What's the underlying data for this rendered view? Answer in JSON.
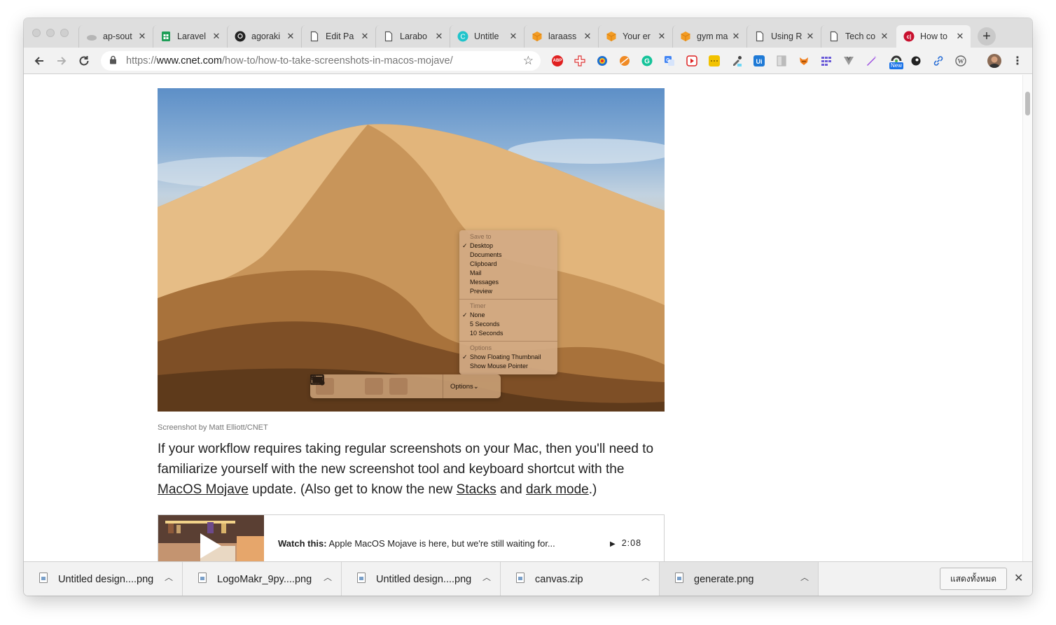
{
  "tabs": [
    {
      "title": "ap-sout",
      "icon": "generic-gray-icon"
    },
    {
      "title": "Laravel",
      "icon": "google-sheets-icon"
    },
    {
      "title": "agoraki",
      "icon": "github-icon"
    },
    {
      "title": "Edit Pa",
      "icon": "document-icon"
    },
    {
      "title": "Larabo",
      "icon": "document-icon"
    },
    {
      "title": "Untitle",
      "icon": "canva-icon"
    },
    {
      "title": "laraass",
      "icon": "orange-cube-icon"
    },
    {
      "title": "Your er",
      "icon": "orange-cube-icon"
    },
    {
      "title": "gym ma",
      "icon": "orange-cube-icon"
    },
    {
      "title": "Using R",
      "icon": "document-icon"
    },
    {
      "title": "Tech co",
      "icon": "document-icon"
    },
    {
      "title": "How to",
      "icon": "cnet-icon",
      "active": true
    }
  ],
  "address": {
    "protocol": "https://",
    "domain": "www.cnet.com",
    "path": "/how-to/how-to-take-screenshots-in-macos-mojave/"
  },
  "extensions": {
    "abp_label": "ABP",
    "new_badge": "New"
  },
  "hero": {
    "menu": {
      "save_to_header": "Save to",
      "save_to": [
        "Desktop",
        "Documents",
        "Clipboard",
        "Mail",
        "Messages",
        "Preview"
      ],
      "timer_header": "Timer",
      "timer": [
        "None",
        "5 Seconds",
        "10 Seconds"
      ],
      "options_header": "Options",
      "options": [
        "Show Floating Thumbnail",
        "Show Mouse Pointer"
      ]
    },
    "toolbar_options_label": "Options⌄"
  },
  "article": {
    "caption": "Screenshot by Matt Elliott/CNET",
    "para_1": "If your workflow requires taking regular screenshots on your Mac, then you'll need to familiarize yourself with the new screenshot tool and keyboard shortcut with the ",
    "link_mojave": "MacOS Mojave",
    "para_2": " update. (Also get to know the new ",
    "link_stacks": "Stacks",
    "para_3": " and ",
    "link_dark": "dark mode",
    "para_4": ".)"
  },
  "video": {
    "label": "Watch this:",
    "title": "Apple MacOS Mojave is here, but we're still waiting for...",
    "duration": "2:08"
  },
  "downloads": [
    {
      "name": "Untitled design....png"
    },
    {
      "name": "LogoMakr_9py....png"
    },
    {
      "name": "Untitled design....png"
    },
    {
      "name": "canvas.zip"
    },
    {
      "name": "generate.png"
    }
  ],
  "shelf": {
    "show_all": "แสดงทั้งหมด"
  }
}
